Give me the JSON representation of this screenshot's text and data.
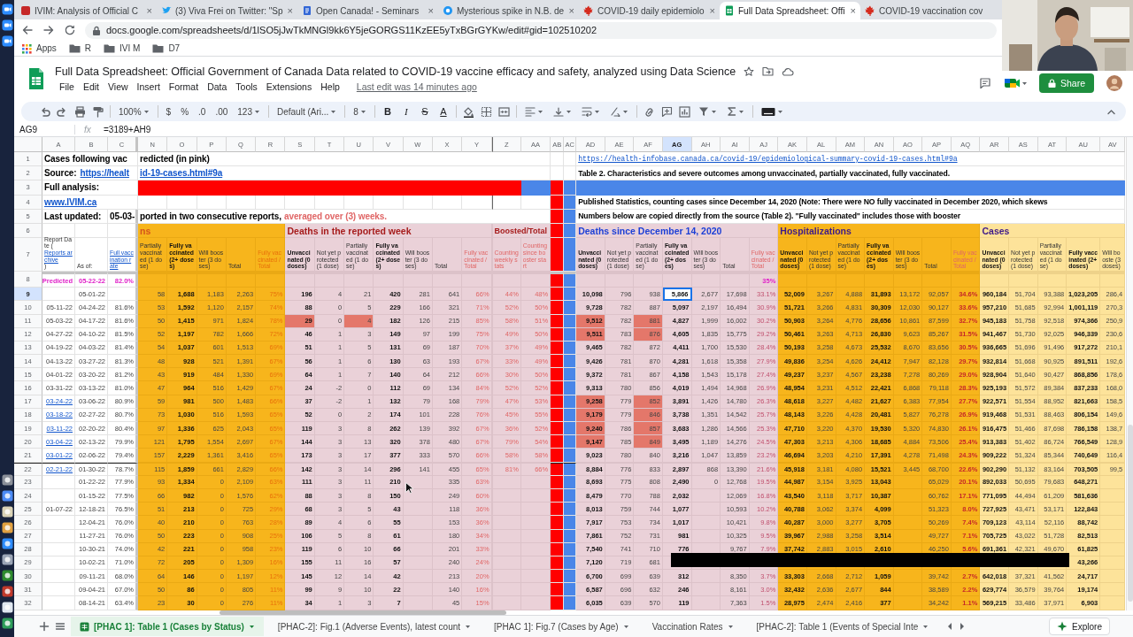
{
  "browser": {
    "tabs": [
      {
        "kind": "square",
        "title": "IVIM: Analysis of Official C",
        "selected": false,
        "close": "×"
      },
      {
        "kind": "bird",
        "title": "(3) Viva Frei on Twitter: \"Sp",
        "selected": false,
        "close": "×"
      },
      {
        "kind": "page",
        "title": "Open Canada! - Seminars",
        "selected": false,
        "close": "×"
      },
      {
        "kind": "disc",
        "title": "Mysterious spike in N.B. de",
        "selected": false,
        "close": "×"
      },
      {
        "kind": "leaf",
        "title": "COVID-19 daily epidemiolo",
        "selected": false,
        "close": "×"
      },
      {
        "kind": "sheet",
        "title": "Full Data Spreadsheet: Offi",
        "selected": true,
        "close": "×"
      },
      {
        "kind": "leaf",
        "title": "COVID-19 vaccination cov",
        "selected": false
      }
    ],
    "address": "docs.google.com/spreadsheets/d/1lSO5jJwTkMNGl9kk6Y5jeGORGS11KzEE5yTxBGrGYKw/edit#gid=102510202",
    "bookmarks": [
      {
        "kind": "apps",
        "label": "Apps"
      },
      {
        "kind": "folder",
        "label": "R"
      },
      {
        "kind": "folder",
        "label": "IVI M"
      },
      {
        "kind": "folder",
        "label": "D7"
      }
    ]
  },
  "doc": {
    "title": "Full Data Spreadsheet: Official Government of Canada Data related to COVID-19 vaccine efficacy and safety, analyzed using Data Science",
    "menu": [
      "File",
      "Edit",
      "View",
      "Insert",
      "Format",
      "Data",
      "Tools",
      "Extensions",
      "Help"
    ],
    "last_edit": "Last edit was 14 minutes ago",
    "share": "Share"
  },
  "toolbar": {
    "zoom": "100%",
    "currency": "$",
    "percent": "%",
    "decrease_decimals": ".0",
    "increase_decimals": ".00",
    "number_format": "123",
    "font": "Default (Ari...",
    "font_size": "8",
    "styles": [
      "B",
      "I",
      "S",
      "A"
    ]
  },
  "formula_bar": {
    "name_box": "AG9",
    "fx": "fx",
    "formula": "=3189+AH9"
  },
  "sheet": {
    "columns": [
      "A",
      "B",
      "C",
      "N",
      "O",
      "P",
      "Q",
      "R",
      "S",
      "T",
      "U",
      "V",
      "W",
      "X",
      "Y",
      "Z",
      "AA",
      "AB",
      "AC",
      "AD",
      "AE",
      "AF",
      "AG",
      "AH",
      "AI",
      "AJ",
      "AK",
      "AL",
      "AM",
      "AN",
      "AO",
      "AP",
      "AQ",
      "AR",
      "AS",
      "AT",
      "AU",
      "AV"
    ],
    "rows": [
      {
        "number": "1",
        "kind": "top",
        "cells": [
          "Cases following vac",
          null,
          null,
          "redicted (in pink)",
          null,
          null,
          null,
          null,
          null,
          null,
          null,
          null,
          null,
          null,
          null,
          null,
          null,
          null,
          null,
          {
            "text": "https://health-infobase.canada.ca/covid-19/epidemiological-summary-covid-19-cases.html#9a",
            "kind": "link_mono"
          }
        ]
      },
      {
        "number": "2",
        "kind": "top",
        "cells": [
          {
            "kind": "label_link",
            "label": "Source:",
            "link": "https://healt"
          },
          null,
          null,
          {
            "text": "id-19-cases.html#9a",
            "kind": "link"
          },
          null,
          null,
          null,
          null,
          null,
          null,
          null,
          null,
          null,
          null,
          null,
          null,
          null,
          null,
          null,
          "Table 2. Characteristics and severe outcomes among unvaccinated, partially vaccinated, fully vaccinated."
        ]
      },
      {
        "number": "3",
        "kind": "top",
        "cells": [
          "Full analysis:",
          null,
          null,
          {
            "color": "#ff0000"
          },
          {
            "color": "#ff0000"
          },
          {
            "color": "#ff0000"
          },
          {
            "color": "#ff0000"
          },
          {
            "color": "#ff0000"
          },
          {
            "color": "#ff0000"
          },
          {
            "color": "#ff0000"
          },
          {
            "color": "#ff0000"
          },
          {
            "color": "#ff0000"
          },
          {
            "color": "#ff0000"
          },
          {
            "color": "#ff0000"
          },
          {
            "color": "#ff0000"
          },
          {
            "color": "#ff0000"
          },
          {
            "color": "#4a86e8"
          },
          null,
          null,
          {
            "color": "#4a86e8"
          },
          {
            "color": "#4a86e8"
          },
          {
            "color": "#4a86e8"
          },
          {
            "color": "#4a86e8"
          },
          {
            "color": "#4a86e8"
          },
          {
            "color": "#4a86e8"
          },
          {
            "color": "#4a86e8"
          },
          {
            "color": "#4a86e8"
          },
          {
            "color": "#4a86e8"
          },
          {
            "color": "#4a86e8"
          },
          {
            "color": "#4a86e8"
          },
          {
            "color": "#4a86e8"
          },
          {
            "color": "#4a86e8"
          },
          {
            "color": "#4a86e8"
          },
          {
            "color": "#4a86e8"
          },
          {
            "color": "#4a86e8"
          },
          {
            "color": "#4a86e8"
          },
          {
            "color": "#4a86e8"
          },
          {
            "color": "#4a86e8"
          }
        ]
      },
      {
        "number": "4",
        "kind": "top",
        "cells": [
          {
            "text": "www.IVIM.ca",
            "kind": "link"
          },
          null,
          null,
          null,
          null,
          null,
          null,
          null,
          null,
          null,
          null,
          null,
          null,
          null,
          null,
          null,
          null,
          null,
          null,
          "Published Statistics, counting cases since December 14, 2020 (Note: There were NO fully vaccinated in December 2020, which skews"
        ]
      },
      {
        "number": "5",
        "kind": "top",
        "cells": [
          "Last updated:",
          null,
          "05-03-",
          {
            "kind": "note",
            "text": "ported in two consecutive reports,",
            "emphasis": "averaged over (3) weeks."
          },
          null,
          null,
          null,
          null,
          null,
          null,
          null,
          null,
          null,
          null,
          null,
          null,
          null,
          null,
          null,
          "Numbers below are copied directly from the source (Table 2). \"Fully vaccinated\" includes those with booster"
        ]
      },
      {
        "number": "6",
        "kind": "group",
        "cells": [
          null,
          null,
          null,
          "ns",
          null,
          null,
          null,
          null,
          "Deaths in the reported week",
          null,
          null,
          null,
          null,
          null,
          null,
          "Boosted/Total",
          null,
          null,
          null,
          "Deaths since December 14, 2020",
          null,
          null,
          null,
          null,
          null,
          null,
          "Hospitalizations",
          null,
          null,
          null,
          null,
          null,
          null,
          "Cases"
        ]
      },
      {
        "number": "7",
        "kind": "header",
        "cells": [
          {
            "kind": "archive_link",
            "before": "Report Date (",
            "link": "Reports archive",
            "after": ")"
          },
          "As of:",
          {
            "text": "Full vaccination rate",
            "kind": "link"
          },
          "Partially vaccinated (1 dose)",
          "Fully vaccinated (2+ doses)",
          "Will booster (3 doses)",
          "Total",
          "Fully vaccinated / Total",
          "Unvaccinated (0 doses)",
          "Not yet protected (1 dose)",
          "Partially vaccinated (1 dose)",
          "Fully vaccinated (2+ doses)",
          "Will booster (3 doses)",
          "Total",
          "Fully vaccinated / Total",
          "Counting weekly stats",
          "Counting since booster start",
          null,
          null,
          "Unvaccinated (0 doses)",
          "Not yet protected (1 dose)",
          "Partially vaccinated (1 dose)",
          "Fully vaccinated (2+ doses)",
          "Will booster (3 doses)",
          "Total",
          "Fully vaccinated / Total",
          "Unvaccinated (0 doses)",
          "Not yet protected (1 dose)",
          "Partially vaccinated (1 dose)",
          "Fully vaccinated (2+ doses)",
          "Will booster (3 doses)",
          "Total",
          "Fully vaccinated / Total",
          "Unvaccinated (0 doses)",
          "Not yet protected (1 dose)",
          "Partially vaccinated (1 dose)",
          "Fully vaccinated (2+ doses)",
          "Will booste (3 doses)"
        ]
      },
      {
        "number": "8",
        "kind": "data",
        "cells": [
          {
            "text": "Predicted",
            "kind": "predicted"
          },
          {
            "text": "05-22-22",
            "kind": "predicted"
          },
          {
            "text": "82.0%",
            "kind": "predicted"
          },
          null,
          null,
          null,
          null,
          null,
          null,
          null,
          null,
          null,
          null,
          null,
          null,
          null,
          null,
          null,
          null,
          null,
          null,
          null,
          null,
          null,
          null,
          {
            "text": "35%",
            "kind": "predicted"
          }
        ]
      },
      {
        "number": "9",
        "kind": "data",
        "cells": [
          null,
          "05-01-22",
          null,
          "58",
          "1,688",
          "1,183",
          "2,263",
          "75%",
          "196",
          "4",
          "21",
          "420",
          "281",
          "641",
          "66%",
          "44%",
          "48%",
          null,
          null,
          "10,098",
          "796",
          "938",
          {
            "text": "5,866",
            "selected": true
          },
          "2,677",
          "17,698",
          "33.1%",
          "52,009",
          "3,267",
          "4,888",
          "31,893",
          "13,172",
          "92,057",
          "34.6%",
          "960,184",
          "51,704",
          "93,388",
          "1,023,205",
          "286,4"
        ]
      },
      {
        "number": "10",
        "kind": "data",
        "cells": [
          "05-11-22",
          "04-24-22",
          "81.6%",
          "53",
          "1,592",
          "1,120",
          "2,157",
          "74%",
          "88",
          "0",
          "5",
          "229",
          "166",
          "321",
          "71%",
          "52%",
          "50%",
          null,
          null,
          "9,728",
          "782",
          "887",
          "5,097",
          "2,197",
          "16,494",
          "30.9%",
          "51,721",
          "3,266",
          "4,831",
          "30,309",
          "12,030",
          "90,127",
          "33.6%",
          "957,210",
          "51,685",
          "92,994",
          "1,001,119",
          "270,3"
        ]
      },
      {
        "number": "11",
        "kind": "data",
        "cells": [
          "05-03-22",
          "04-17-22",
          "81.6%",
          "50",
          "1,415",
          "971",
          "1,824",
          "78%",
          {
            "text": "29",
            "highlighted": true
          },
          "0",
          {
            "text": "4",
            "highlighted": true
          },
          "182",
          "126",
          "215",
          "85%",
          "58%",
          "51%",
          null,
          null,
          {
            "text": "9,512",
            "highlighted": true
          },
          "782",
          {
            "text": "881",
            "highlighted": true
          },
          "4,827",
          "1,999",
          "16,002",
          "30.2%",
          "50,903",
          "3,264",
          "4,776",
          "28,656",
          "10,861",
          "87,599",
          "32.7%",
          "945,183",
          "51,758",
          "92,518",
          "974,366",
          "250,9"
        ]
      },
      {
        "number": "12",
        "kind": "data",
        "cells": [
          "04-27-22",
          "04-10-22",
          "81.5%",
          "52",
          "1,197",
          "782",
          "1,666",
          "72%",
          "46",
          "1",
          "3",
          "149",
          "97",
          "199",
          "75%",
          "49%",
          "50%",
          null,
          null,
          {
            "text": "9,511",
            "highlighted": true
          },
          "783",
          {
            "text": "876",
            "highlighted": true
          },
          "4,605",
          "1,835",
          "15,775",
          "29.2%",
          "50,461",
          "3,263",
          "4,713",
          "26,830",
          "9,623",
          "85,267",
          "31.5%",
          "941,467",
          "51,730",
          "92,025",
          "946,339",
          "230,6"
        ]
      },
      {
        "number": "13",
        "kind": "data",
        "cells": [
          "04-19-22",
          "04-03-22",
          "81.4%",
          "54",
          "1,037",
          "601",
          "1,513",
          "69%",
          "51",
          "1",
          "5",
          "131",
          "69",
          "187",
          "70%",
          "37%",
          "49%",
          null,
          null,
          "9,465",
          "782",
          "872",
          "4,411",
          "1,700",
          "15,530",
          "28.4%",
          "50,193",
          "3,258",
          "4,673",
          "25,532",
          "8,670",
          "83,656",
          "30.5%",
          "936,665",
          "51,696",
          "91,496",
          "917,272",
          "210,1"
        ]
      },
      {
        "number": "14",
        "kind": "data",
        "cells": [
          "04-13-22",
          "03-27-22",
          "81.3%",
          "48",
          "928",
          "521",
          "1,391",
          "67%",
          "56",
          "1",
          "6",
          "130",
          "63",
          "193",
          "67%",
          "33%",
          "49%",
          null,
          null,
          "9,426",
          "781",
          "870",
          "4,281",
          "1,618",
          "15,358",
          "27.9%",
          "49,836",
          "3,254",
          "4,626",
          "24,412",
          "7,947",
          "82,128",
          "29.7%",
          "932,814",
          "51,668",
          "90,925",
          "891,511",
          "192,6"
        ]
      },
      {
        "number": "15",
        "kind": "data",
        "cells": [
          "04-01-22",
          "03-20-22",
          "81.2%",
          "43",
          "919",
          "484",
          "1,330",
          "69%",
          "64",
          "1",
          "7",
          "140",
          "64",
          "212",
          "66%",
          "30%",
          "50%",
          null,
          null,
          "9,372",
          "781",
          "867",
          "4,158",
          "1,543",
          "15,178",
          "27.4%",
          "49,237",
          "3,237",
          "4,567",
          "23,238",
          "7,278",
          "80,269",
          "29.0%",
          "928,904",
          "51,640",
          "90,427",
          "868,856",
          "178,6"
        ]
      },
      {
        "number": "16",
        "kind": "data",
        "cells": [
          "03-31-22",
          "03-13-22",
          "81.0%",
          "47",
          "964",
          "516",
          "1,429",
          "67%",
          "24",
          "-2",
          "0",
          "112",
          "69",
          "134",
          "84%",
          "52%",
          "52%",
          null,
          null,
          "9,313",
          "780",
          "856",
          "4,019",
          "1,494",
          "14,968",
          "26.9%",
          "48,954",
          "3,231",
          "4,512",
          "22,421",
          "6,868",
          "79,118",
          "28.3%",
          "925,193",
          "51,572",
          "89,384",
          "837,233",
          "168,0"
        ]
      },
      {
        "number": "17",
        "kind": "data",
        "cells": [
          {
            "text": "03-24-22",
            "kind": "link"
          },
          "03-06-22",
          "80.9%",
          "59",
          "981",
          "500",
          "1,483",
          "66%",
          "37",
          "-2",
          "1",
          "132",
          "79",
          "168",
          "79%",
          "47%",
          "53%",
          null,
          null,
          {
            "text": "9,258",
            "highlighted": true
          },
          "779",
          {
            "text": "852",
            "highlighted": true
          },
          "3,891",
          "1,426",
          "14,780",
          "26.3%",
          "48,618",
          "3,227",
          "4,482",
          "21,627",
          "6,383",
          "77,954",
          "27.7%",
          "922,571",
          "51,554",
          "88,952",
          "821,663",
          "158,5"
        ]
      },
      {
        "number": "18",
        "kind": "data",
        "cells": [
          {
            "text": "03-18-22",
            "kind": "link"
          },
          "02-27-22",
          "80.7%",
          "73",
          "1,030",
          "516",
          "1,593",
          "65%",
          "52",
          "0",
          "2",
          "174",
          "101",
          "228",
          "76%",
          "45%",
          "55%",
          null,
          null,
          {
            "text": "9,179",
            "highlighted": true
          },
          "779",
          {
            "text": "846",
            "highlighted": true
          },
          "3,738",
          "1,351",
          "14,542",
          "25.7%",
          "48,143",
          "3,226",
          "4,428",
          "20,481",
          "5,827",
          "76,278",
          "26.9%",
          "919,468",
          "51,531",
          "88,463",
          "806,154",
          "149,6"
        ]
      },
      {
        "number": "19",
        "kind": "data",
        "cells": [
          {
            "text": "03-11-22",
            "kind": "link"
          },
          "02-20-22",
          "80.4%",
          "97",
          "1,336",
          "625",
          "2,043",
          "65%",
          "119",
          "3",
          "8",
          "262",
          "139",
          "392",
          "67%",
          "36%",
          "52%",
          null,
          null,
          {
            "text": "9,240",
            "highlighted": true
          },
          "786",
          {
            "text": "857",
            "highlighted": true
          },
          "3,683",
          "1,286",
          "14,566",
          "25.3%",
          "47,710",
          "3,220",
          "4,370",
          "19,530",
          "5,320",
          "74,830",
          "26.1%",
          "916,475",
          "51,466",
          "87,698",
          "786,158",
          "138,7"
        ]
      },
      {
        "number": "20",
        "kind": "data",
        "cells": [
          {
            "text": "03-04-22",
            "kind": "link"
          },
          "02-13-22",
          "79.9%",
          "121",
          "1,795",
          "1,554",
          "2,697",
          "67%",
          "144",
          "3",
          "13",
          "320",
          "378",
          "480",
          "67%",
          "79%",
          "54%",
          null,
          null,
          {
            "text": "9,147",
            "highlighted": true
          },
          "785",
          {
            "text": "849",
            "highlighted": true
          },
          "3,495",
          "1,189",
          "14,276",
          "24.5%",
          "47,303",
          "3,213",
          "4,306",
          "18,685",
          "4,884",
          "73,506",
          "25.4%",
          "913,383",
          "51,402",
          "86,724",
          "766,549",
          "128,9"
        ]
      },
      {
        "number": "21",
        "kind": "data",
        "cells": [
          {
            "text": "03-01-22",
            "kind": "link"
          },
          "02-06-22",
          "79.4%",
          "157",
          "2,229",
          "1,361",
          "3,416",
          "65%",
          "173",
          "3",
          "17",
          "377",
          "333",
          "570",
          "66%",
          "58%",
          "58%",
          null,
          null,
          "9,023",
          "780",
          "840",
          "3,216",
          "1,047",
          "13,859",
          "23.2%",
          "46,694",
          "3,203",
          "4,210",
          "17,391",
          "4,278",
          "71,498",
          "24.3%",
          "909,222",
          "51,324",
          "85,344",
          "740,649",
          "116,4"
        ]
      },
      {
        "number": "22",
        "kind": "data",
        "divider_above": true,
        "cells": [
          {
            "text": "02-21-22",
            "kind": "link"
          },
          "01-30-22",
          "78.7%",
          "115",
          "1,859",
          "661",
          "2,829",
          "66%",
          "142",
          "3",
          "14",
          "296",
          "141",
          "455",
          "65%",
          "81%",
          "66%",
          null,
          null,
          "8,884",
          "776",
          "833",
          "2,897",
          "868",
          "13,390",
          "21.6%",
          "45,918",
          "3,181",
          "4,080",
          "15,521",
          "3,445",
          "68,700",
          "22.6%",
          "902,290",
          "51,132",
          "83,164",
          "703,505",
          "99,5"
        ]
      },
      {
        "number": "23",
        "kind": "data",
        "cells": [
          null,
          "01-22-22",
          "77.9%",
          "93",
          "1,334",
          "0",
          "2,109",
          "63%",
          "111",
          "3",
          "11",
          "210",
          null,
          "335",
          "63%",
          null,
          null,
          null,
          null,
          "8,693",
          "775",
          "808",
          "2,490",
          "0",
          "12,768",
          "19.5%",
          "44,987",
          "3,154",
          "3,925",
          "13,043",
          null,
          "65,029",
          "20.1%",
          "892,033",
          "50,695",
          "79,683",
          "648,271"
        ]
      },
      {
        "number": "24",
        "kind": "data",
        "cells": [
          null,
          "01-15-22",
          "77.5%",
          "66",
          "982",
          "0",
          "1,576",
          "62%",
          "88",
          "3",
          "8",
          "150",
          null,
          "249",
          "60%",
          null,
          null,
          null,
          null,
          "8,479",
          "770",
          "788",
          "2,032",
          null,
          "12,069",
          "16.8%",
          "43,540",
          "3,118",
          "3,717",
          "10,387",
          null,
          "60,762",
          "17.1%",
          "771,095",
          "44,494",
          "61,209",
          "581,636"
        ]
      },
      {
        "number": "25",
        "kind": "data",
        "cells": [
          "01-07-22",
          "12-18-21",
          "76.5%",
          "51",
          "213",
          "0",
          "725",
          "29%",
          "68",
          "3",
          "5",
          "43",
          null,
          "118",
          "36%",
          null,
          null,
          null,
          null,
          "8,013",
          "759",
          "744",
          "1,077",
          null,
          "10,593",
          "10.2%",
          "40,788",
          "3,062",
          "3,374",
          "4,099",
          null,
          "51,323",
          "8.0%",
          "727,925",
          "43,471",
          "53,171",
          "122,843"
        ]
      },
      {
        "number": "26",
        "kind": "data",
        "cells": [
          null,
          "12-04-21",
          "76.0%",
          "40",
          "210",
          "0",
          "763",
          "28%",
          "89",
          "4",
          "6",
          "55",
          null,
          "153",
          "36%",
          null,
          null,
          null,
          null,
          "7,917",
          "753",
          "734",
          "1,017",
          null,
          "10,421",
          "9.8%",
          "40,287",
          "3,000",
          "3,277",
          "3,705",
          null,
          "50,269",
          "7.4%",
          "709,123",
          "43,114",
          "52,116",
          "88,742"
        ]
      },
      {
        "number": "27",
        "kind": "data",
        "cells": [
          null,
          "11-27-21",
          "76.0%",
          "50",
          "223",
          "0",
          "908",
          "25%",
          "106",
          "5",
          "8",
          "61",
          null,
          "180",
          "34%",
          null,
          null,
          null,
          null,
          "7,861",
          "752",
          "731",
          "981",
          null,
          "10,325",
          "9.5%",
          "39,967",
          "2,988",
          "3,258",
          "3,514",
          null,
          "49,727",
          "7.1%",
          "705,725",
          "43,022",
          "51,728",
          "82,513"
        ]
      },
      {
        "number": "28",
        "kind": "data",
        "cells": [
          null,
          "10-30-21",
          "74.0%",
          "42",
          "221",
          "0",
          "958",
          "23%",
          "119",
          "6",
          "10",
          "66",
          null,
          "201",
          "33%",
          null,
          null,
          null,
          null,
          "7,540",
          "741",
          "710",
          "776",
          null,
          "9,767",
          "7.9%",
          "37,742",
          "2,883",
          "3,015",
          "2,610",
          null,
          "46,250",
          "5.6%",
          "691,361",
          "42,321",
          "49,670",
          "61,825"
        ]
      },
      {
        "number": "29",
        "kind": "data",
        "cells": [
          null,
          "10-02-21",
          "71.0%",
          "72",
          "205",
          "0",
          "1,309",
          "16%",
          "155",
          "11",
          "16",
          "57",
          null,
          "240",
          "24%",
          null,
          null,
          null,
          null,
          "7,120",
          "719",
          "681",
          null,
          null,
          null,
          null,
          null,
          null,
          null,
          null,
          null,
          null,
          null,
          null,
          null,
          null,
          "43,266"
        ]
      },
      {
        "number": "30",
        "kind": "data",
        "cells": [
          null,
          "09-11-21",
          "68.0%",
          "64",
          "146",
          "0",
          "1,197",
          "12%",
          "145",
          "12",
          "14",
          "42",
          null,
          "213",
          "20%",
          null,
          null,
          null,
          null,
          "6,700",
          "699",
          "639",
          "312",
          null,
          "8,350",
          "3.7%",
          "33,303",
          "2,668",
          "2,712",
          "1,059",
          null,
          "39,742",
          "2.7%",
          "642,018",
          "37,321",
          "41,562",
          "24,717"
        ]
      },
      {
        "number": "31",
        "kind": "data",
        "cells": [
          null,
          "09-04-21",
          "67.0%",
          "50",
          "86",
          "0",
          "805",
          "11%",
          "99",
          "9",
          "10",
          "22",
          null,
          "140",
          "16%",
          null,
          null,
          null,
          null,
          "6,587",
          "696",
          "632",
          "246",
          null,
          "8,161",
          "3.0%",
          "32,432",
          "2,636",
          "2,677",
          "844",
          null,
          "38,589",
          "2.2%",
          "629,774",
          "36,579",
          "39,764",
          "19,174"
        ]
      },
      {
        "number": "32",
        "kind": "data",
        "cells": [
          null,
          "08-14-21",
          "63.4%",
          "23",
          "30",
          "0",
          "276",
          "11%",
          "34",
          "1",
          "3",
          "7",
          null,
          "45",
          "15%",
          null,
          null,
          null,
          null,
          "6,035",
          "639",
          "570",
          "119",
          null,
          "7,363",
          "1.5%",
          "28,975",
          "2,474",
          "2,416",
          "377",
          null,
          "34,242",
          "1.1%",
          "569,215",
          "33,486",
          "37,971",
          "6,903"
        ]
      }
    ]
  },
  "sheet_tabs": [
    {
      "label": "[PHAC 1]: Table 1 (Cases by Status)",
      "selected": true
    },
    {
      "label": "[PHAC-2]: Fig.1 (Adverse Events), latest count",
      "selected": false
    },
    {
      "label": "[PHAC 1]: Fig.7 (Cases by Age)",
      "selected": false
    },
    {
      "label": "Vaccination Rates",
      "selected": false
    },
    {
      "label": "[PHAC-2]: Table 1 (Events of Special Inte",
      "selected": false
    }
  ],
  "explore": "Explore"
}
